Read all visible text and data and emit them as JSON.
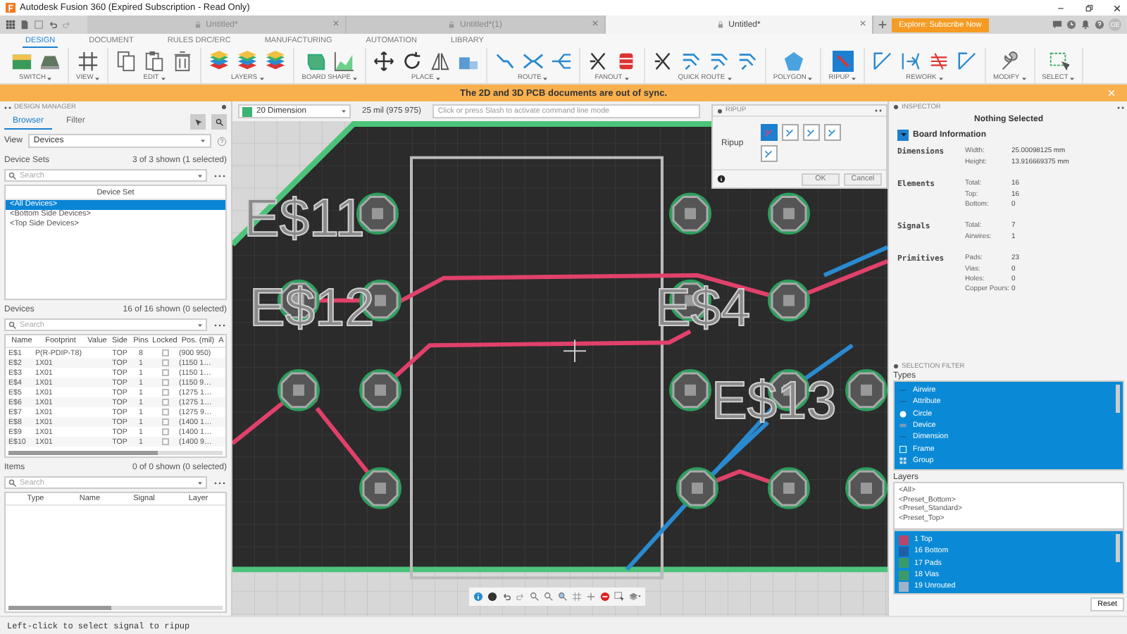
{
  "window": {
    "title": "Autodesk Fusion 360 (Expired Subscription - Read Only)"
  },
  "document_tabs": [
    {
      "label": "Untitled*",
      "selected": false
    },
    {
      "label": "Untitled*(1)",
      "selected": false
    },
    {
      "label": "Untitled*",
      "selected": true
    }
  ],
  "subscribe_button": "Explore: Subscribe Now",
  "user_initials": "GE",
  "ribbon_tabs": [
    {
      "label": "DESIGN",
      "selected": true
    },
    {
      "label": "DOCUMENT",
      "selected": false
    },
    {
      "label": "RULES DRC/ERC",
      "selected": false
    },
    {
      "label": "MANUFACTURING",
      "selected": false
    },
    {
      "label": "AUTOMATION",
      "selected": false
    },
    {
      "label": "LIBRARY",
      "selected": false
    }
  ],
  "ribbon_groups": [
    {
      "label": "SWITCH",
      "tools": [
        {
          "kind": "board"
        },
        {
          "kind": "schematic"
        }
      ]
    },
    {
      "label": "VIEW",
      "tools": [
        {
          "kind": "grid"
        }
      ]
    },
    {
      "label": "EDIT",
      "tools": [
        {
          "kind": "copy"
        },
        {
          "kind": "paste"
        },
        {
          "kind": "trash"
        }
      ]
    },
    {
      "label": "LAYERS",
      "tools": [
        {
          "kind": "layers"
        },
        {
          "kind": "layers"
        },
        {
          "kind": "layers"
        }
      ]
    },
    {
      "label": "BOARD SHAPE",
      "tools": [
        {
          "kind": "shape"
        },
        {
          "kind": "chart"
        }
      ]
    },
    {
      "label": "PLACE",
      "tools": [
        {
          "kind": "move"
        },
        {
          "kind": "rotate"
        },
        {
          "kind": "mirror"
        },
        {
          "kind": "align"
        }
      ]
    },
    {
      "label": "ROUTE",
      "tools": [
        {
          "kind": "route"
        },
        {
          "kind": "split"
        },
        {
          "kind": "bus"
        }
      ]
    },
    {
      "label": "FANOUT",
      "tools": [
        {
          "kind": "fanout"
        },
        {
          "kind": "spool"
        }
      ]
    },
    {
      "label": "QUICK ROUTE",
      "tools": [
        {
          "kind": "fanout"
        },
        {
          "kind": "quickroute"
        },
        {
          "kind": "quickroute"
        },
        {
          "kind": "quickroute"
        }
      ]
    },
    {
      "label": "POLYGON",
      "tools": [
        {
          "kind": "polygon"
        }
      ]
    },
    {
      "label": "RIPUP",
      "tools": [
        {
          "kind": "ripup"
        }
      ]
    },
    {
      "label": "REWORK",
      "tools": [
        {
          "kind": "rework"
        },
        {
          "kind": "arrow"
        },
        {
          "kind": "lines"
        },
        {
          "kind": "rework"
        }
      ]
    },
    {
      "label": "MODIFY",
      "tools": [
        {
          "kind": "wrench"
        }
      ]
    },
    {
      "label": "SELECT",
      "tools": [
        {
          "kind": "select"
        }
      ]
    }
  ],
  "banner": {
    "message": "The 2D and 3D PCB documents are out of sync."
  },
  "design_manager": {
    "title": "DESIGN MANAGER",
    "tabs": [
      {
        "label": "Browser",
        "selected": true
      },
      {
        "label": "Filter",
        "selected": false
      }
    ],
    "view_label": "View",
    "view_value": "Devices",
    "device_sets": {
      "title": "Device Sets",
      "count": "3 of 3 shown (1 selected)",
      "search_placeholder": "Search",
      "column": "Device Set",
      "rows": [
        {
          "label": "<All Devices>",
          "selected": true
        },
        {
          "label": "<Bottom Side Devices>",
          "selected": false
        },
        {
          "label": "<Top Side Devices>",
          "selected": false
        }
      ]
    },
    "devices": {
      "title": "Devices",
      "count": "16 of 16 shown (0 selected)",
      "search_placeholder": "Search",
      "columns": [
        "Name",
        "Footprint",
        "Value",
        "Side",
        "Pins",
        "Locked",
        "Pos. (mil)",
        "A"
      ],
      "rows": [
        {
          "name": "E$1",
          "footprint": "P(R-PDIP-T8)",
          "side": "TOP",
          "pins": "8",
          "locked": false,
          "pos": "(900 950)"
        },
        {
          "name": "E$2",
          "footprint": "1X01",
          "side": "TOP",
          "pins": "1",
          "locked": false,
          "pos": "(1150 1…"
        },
        {
          "name": "E$3",
          "footprint": "1X01",
          "side": "TOP",
          "pins": "1",
          "locked": false,
          "pos": "(1150 1…"
        },
        {
          "name": "E$4",
          "footprint": "1X01",
          "side": "TOP",
          "pins": "1",
          "locked": false,
          "pos": "(1150 9…"
        },
        {
          "name": "E$5",
          "footprint": "1X01",
          "side": "TOP",
          "pins": "1",
          "locked": false,
          "pos": "(1275 1…"
        },
        {
          "name": "E$6",
          "footprint": "1X01",
          "side": "TOP",
          "pins": "1",
          "locked": false,
          "pos": "(1275 1…"
        },
        {
          "name": "E$7",
          "footprint": "1X01",
          "side": "TOP",
          "pins": "1",
          "locked": false,
          "pos": "(1275 9…"
        },
        {
          "name": "E$8",
          "footprint": "1X01",
          "side": "TOP",
          "pins": "1",
          "locked": false,
          "pos": "(1400 1…"
        },
        {
          "name": "E$9",
          "footprint": "1X01",
          "side": "TOP",
          "pins": "1",
          "locked": false,
          "pos": "(1400 1…"
        },
        {
          "name": "E$10",
          "footprint": "1X01",
          "side": "TOP",
          "pins": "1",
          "locked": false,
          "pos": "(1400 9…"
        }
      ]
    },
    "items": {
      "title": "Items",
      "count": "0 of 0 shown (0 selected)",
      "search_placeholder": "Search",
      "columns": [
        "Type",
        "Name",
        "Signal",
        "Layer"
      ]
    }
  },
  "canvas": {
    "layer": {
      "name": "20 Dimension",
      "color": "#3cb371"
    },
    "coordinates": "25 mil (975 975)",
    "command_placeholder": "Click or press Slash to activate command line mode",
    "board_labels": [
      "E$11",
      "E$12",
      "E$4",
      "E$13"
    ]
  },
  "ripup": {
    "title": "RIPUP",
    "label": "Ripup",
    "options": [
      {
        "selected": true
      },
      {
        "selected": false
      },
      {
        "selected": false
      },
      {
        "selected": false
      },
      {
        "selected": false
      }
    ],
    "buttons": [
      "OK",
      "Cancel"
    ]
  },
  "inspector": {
    "title": "INSPECTOR",
    "subtitle": "Nothing Selected",
    "section": {
      "title": "Board Information",
      "expanded": true
    },
    "groups": [
      {
        "title": "Dimensions",
        "rows": [
          {
            "label": "Width:",
            "value": "25.00098125 mm"
          },
          {
            "label": "Height:",
            "value": "13.916669375 mm"
          }
        ]
      },
      {
        "title": "Elements",
        "rows": [
          {
            "label": "Total:",
            "value": "16"
          },
          {
            "label": "Top:",
            "value": "16"
          },
          {
            "label": "Bottom:",
            "value": "0"
          }
        ]
      },
      {
        "title": "Signals",
        "rows": [
          {
            "label": "Total:",
            "value": "7"
          },
          {
            "label": "Airwires:",
            "value": "1"
          }
        ]
      },
      {
        "title": "Primitives",
        "rows": [
          {
            "label": "Pads:",
            "value": "23"
          },
          {
            "label": "Vias:",
            "value": "0"
          },
          {
            "label": "Holes:",
            "value": "0"
          },
          {
            "label": "Copper Pours:",
            "value": "0"
          }
        ]
      }
    ]
  },
  "selection_filter": {
    "title": "SELECTION FILTER",
    "types_label": "Types",
    "types": [
      {
        "label": "Airwire",
        "kind": "line",
        "selected": true
      },
      {
        "label": "Attribute",
        "kind": "line",
        "selected": true
      },
      {
        "label": "Circle",
        "kind": "circle",
        "selected": true
      },
      {
        "label": "Device",
        "kind": "device",
        "selected": true
      },
      {
        "label": "Dimension",
        "kind": "line",
        "selected": true
      },
      {
        "label": "Frame",
        "kind": "frame",
        "selected": true
      },
      {
        "label": "Group",
        "kind": "group",
        "selected": true
      }
    ],
    "layers_label": "Layers",
    "presets": [
      {
        "label": "<All>",
        "selected": false
      },
      {
        "label": "<Preset_Bottom>",
        "selected": false
      },
      {
        "label": "<Preset_Standard>",
        "selected": false
      },
      {
        "label": "<Preset_Top>",
        "selected": false
      }
    ],
    "layers": [
      {
        "label": "1 Top",
        "color": "#b5476b",
        "selected": true
      },
      {
        "label": "16 Bottom",
        "color": "#1f5fa8",
        "selected": true
      },
      {
        "label": "17 Pads",
        "color": "#3c9a6a",
        "selected": true
      },
      {
        "label": "18 Vias",
        "color": "#3c9a6a",
        "selected": true
      },
      {
        "label": "19 Unrouted",
        "color": "#9fb3c8",
        "selected": true
      }
    ],
    "reset_button": "Reset"
  },
  "status_bar": "Left-click to select signal to ripup"
}
